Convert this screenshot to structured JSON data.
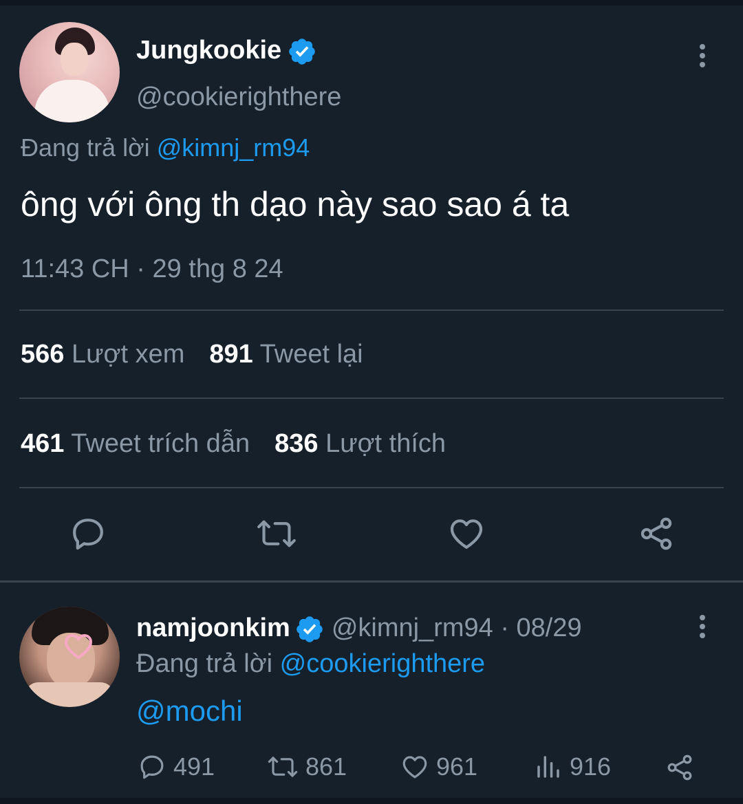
{
  "main_tweet": {
    "display_name": "Jungkookie",
    "handle": "@cookierighthere",
    "replying_prefix": "Đang trả lời",
    "replying_to": "@kimnj_rm94",
    "text": "ông với ông th dạo này sao sao á ta",
    "timestamp": "11:43 CH · 29 thg 8 24",
    "stats": {
      "views_count": "566",
      "views_label": "Lượt xem",
      "retweets_count": "891",
      "retweets_label": "Tweet lại",
      "quotes_count": "461",
      "quotes_label": "Tweet trích dẫn",
      "likes_count": "836",
      "likes_label": "Lượt thích"
    },
    "action_icons": [
      "reply-icon",
      "retweet-icon",
      "like-icon",
      "share-icon"
    ]
  },
  "reply_tweet": {
    "display_name": "namjoonkim",
    "handle_date": "@kimnj_rm94 · 08/29",
    "replying_prefix": "Đang trả lời",
    "replying_to": "@cookierighthere",
    "text": "@mochi",
    "counts": {
      "replies": "491",
      "retweets": "861",
      "likes": "961",
      "views": "916"
    }
  },
  "colors": {
    "background": "#15202b",
    "link": "#1d9bf0",
    "muted": "#8b98a5",
    "divider": "#38444d"
  }
}
